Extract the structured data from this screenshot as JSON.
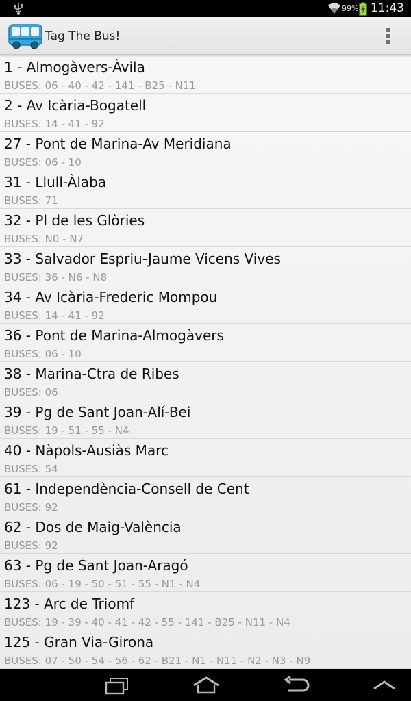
{
  "status_bar": {
    "battery_percent": "99%",
    "time": "11:43",
    "icons": [
      "usb-icon",
      "wifi-icon",
      "battery-charging-icon"
    ]
  },
  "action_bar": {
    "app_icon": "bus-icon",
    "title": "Tag The Bus!",
    "overflow_icon": "overflow-menu-icon"
  },
  "stops": [
    {
      "name": "1 - Almogàvers-Àvila",
      "buses": "BUSES: 06 - 40 - 42 - 141 - B25 - N11"
    },
    {
      "name": "2 - Av Icària-Bogatell",
      "buses": "BUSES: 14 - 41 - 92"
    },
    {
      "name": "27 - Pont de Marina-Av Meridiana",
      "buses": "BUSES: 06 - 10"
    },
    {
      "name": "31 - Llull-Àlaba",
      "buses": "BUSES: 71"
    },
    {
      "name": "32 - Pl de les Glòries",
      "buses": "BUSES: N0 - N7"
    },
    {
      "name": "33 - Salvador Espriu-Jaume Vicens Vives",
      "buses": "BUSES: 36 - N6 - N8"
    },
    {
      "name": "34 - Av Icària-Frederic Mompou",
      "buses": "BUSES: 14 - 41 - 92"
    },
    {
      "name": "36 - Pont de Marina-Almogàvers",
      "buses": "BUSES: 06 - 10"
    },
    {
      "name": "38 - Marina-Ctra de Ribes",
      "buses": "BUSES: 06"
    },
    {
      "name": "39 - Pg de Sant Joan-Alí-Bei",
      "buses": "BUSES: 19 - 51 - 55 - N4"
    },
    {
      "name": "40 - Nàpols-Ausiàs Marc",
      "buses": "BUSES: 54"
    },
    {
      "name": "61 - Independència-Consell de Cent",
      "buses": "BUSES: 92"
    },
    {
      "name": "62 - Dos de Maig-València",
      "buses": "BUSES: 92"
    },
    {
      "name": "63 - Pg de Sant Joan-Aragó",
      "buses": "BUSES: 06 - 19 - 50 - 51 - 55 - N1 - N4"
    },
    {
      "name": "123 - Arc de Triomf",
      "buses": "BUSES: 19 - 39 - 40 - 41 - 42 - 55 - 141 - B25 - N11 - N4"
    },
    {
      "name": "125 - Gran Via-Girona",
      "buses": "BUSES: 07 - 50 - 54 - 56 - 62 - B21 - N1 - N11 - N2 - N3 - N9"
    }
  ],
  "nav_bar": {
    "buttons": [
      "recent-apps-icon",
      "home-icon",
      "back-icon",
      "collapse-icon"
    ]
  },
  "colors": {
    "accent_bus": "#3ba6dc",
    "secondary_text": "#9a9a9a",
    "divider": "#d9d9d9"
  }
}
